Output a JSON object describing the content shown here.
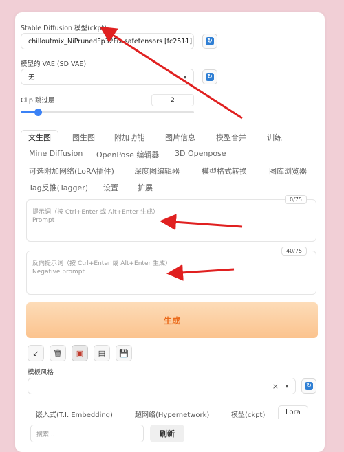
{
  "checkpoint": {
    "label": "Stable Diffusion 模型(ckpt)",
    "value": "chilloutmix_NiPrunedFp32Fix.safetensors [fc2511]"
  },
  "vae": {
    "label": "模型的 VAE (SD VAE)",
    "value": "无"
  },
  "clip": {
    "label": "Clip 跳过层",
    "value": "2",
    "level": 0.1
  },
  "main_tabs": [
    "文生图",
    "图生图",
    "附加功能",
    "图片信息",
    "模型合并",
    "训练"
  ],
  "ext_tabs_row1": [
    "Mine Diffusion",
    "OpenPose 编辑器",
    "3D Openpose"
  ],
  "ext_tabs_row2": [
    "可选附加网络(LoRA插件)",
    "深度图编辑器",
    "模型格式转换",
    "图库浏览器"
  ],
  "ext_tabs_row3": [
    "Tag反推(Tagger)",
    "设置",
    "扩展"
  ],
  "prompt": {
    "counter": "0/75",
    "placeholder_cn": "提示词（按 Ctrl+Enter 或 Alt+Enter 生成）",
    "placeholder_en": "Prompt"
  },
  "negative_prompt": {
    "counter": "40/75",
    "placeholder_cn": "反向提示词（按 Ctrl+Enter 或 Alt+Enter 生成）",
    "placeholder_en": "Negative prompt"
  },
  "generate_label": "生成",
  "tools": [
    "↙",
    "🗑",
    "▣",
    "▤",
    "💾"
  ],
  "styles": {
    "label": "模板风格",
    "clear": "×"
  },
  "sub_tabs": [
    "嵌入式(T.I. Embedding)",
    "超网络(Hypernetwork)",
    "模型(ckpt)",
    "Lora"
  ],
  "search": {
    "placeholder": "搜索..."
  },
  "refresh_label": "刷新",
  "colors": {
    "background": "#f1cfd6",
    "accent": "#3b82f6",
    "generate_text": "#ea6a1a",
    "annotation_arrow": "#e02020"
  }
}
